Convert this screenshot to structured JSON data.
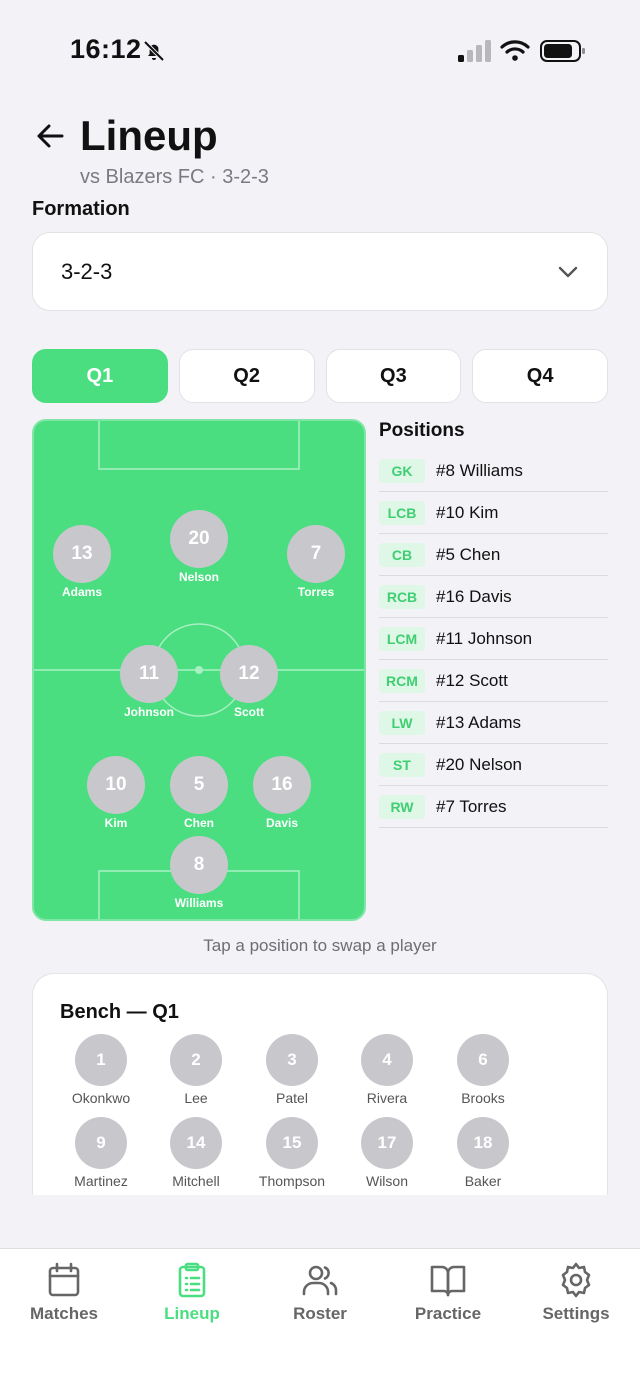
{
  "status_bar": {
    "time": "16:12"
  },
  "header": {
    "title": "Lineup",
    "subtitle": "vs Blazers FC · 3-2-3"
  },
  "formation": {
    "label": "Formation",
    "value": "3-2-3"
  },
  "tabs": [
    {
      "label": "Q1",
      "active": true
    },
    {
      "label": "Q2",
      "active": false
    },
    {
      "label": "Q3",
      "active": false
    },
    {
      "label": "Q4",
      "active": false
    }
  ],
  "pitch_players": [
    {
      "number": "13",
      "name": "Adams"
    },
    {
      "number": "20",
      "name": "Nelson"
    },
    {
      "number": "7",
      "name": "Torres"
    },
    {
      "number": "11",
      "name": "Johnson"
    },
    {
      "number": "12",
      "name": "Scott"
    },
    {
      "number": "10",
      "name": "Kim"
    },
    {
      "number": "5",
      "name": "Chen"
    },
    {
      "number": "16",
      "name": "Davis"
    },
    {
      "number": "8",
      "name": "Williams"
    }
  ],
  "positions": {
    "title": "Positions",
    "rows": [
      {
        "pos": "GK",
        "player": "#8 Williams"
      },
      {
        "pos": "LCB",
        "player": "#10 Kim"
      },
      {
        "pos": "CB",
        "player": "#5 Chen"
      },
      {
        "pos": "RCB",
        "player": "#16 Davis"
      },
      {
        "pos": "LCM",
        "player": "#11 Johnson"
      },
      {
        "pos": "RCM",
        "player": "#12 Scott"
      },
      {
        "pos": "LW",
        "player": "#13 Adams"
      },
      {
        "pos": "ST",
        "player": "#20 Nelson"
      },
      {
        "pos": "RW",
        "player": "#7 Torres"
      }
    ]
  },
  "hint": "Tap a position to swap a player",
  "bench": {
    "title": "Bench — Q1",
    "players": [
      {
        "number": "1",
        "name": "Okonkwo"
      },
      {
        "number": "2",
        "name": "Lee"
      },
      {
        "number": "3",
        "name": "Patel"
      },
      {
        "number": "4",
        "name": "Rivera"
      },
      {
        "number": "6",
        "name": "Brooks"
      },
      {
        "number": "9",
        "name": "Martinez"
      },
      {
        "number": "14",
        "name": "Mitchell"
      },
      {
        "number": "15",
        "name": "Thompson"
      },
      {
        "number": "17",
        "name": "Wilson"
      },
      {
        "number": "18",
        "name": "Baker"
      }
    ]
  },
  "nav": [
    {
      "label": "Matches",
      "icon": "calendar-icon",
      "active": false
    },
    {
      "label": "Lineup",
      "icon": "clipboard-icon",
      "active": true
    },
    {
      "label": "Roster",
      "icon": "users-icon",
      "active": false
    },
    {
      "label": "Practice",
      "icon": "book-icon",
      "active": false
    },
    {
      "label": "Settings",
      "icon": "gear-icon",
      "active": false
    }
  ],
  "colors": {
    "accent": "#4ade80",
    "pitch": "#4ade80",
    "badge_bg": "#dff7e7",
    "background": "#f2f2f7"
  }
}
